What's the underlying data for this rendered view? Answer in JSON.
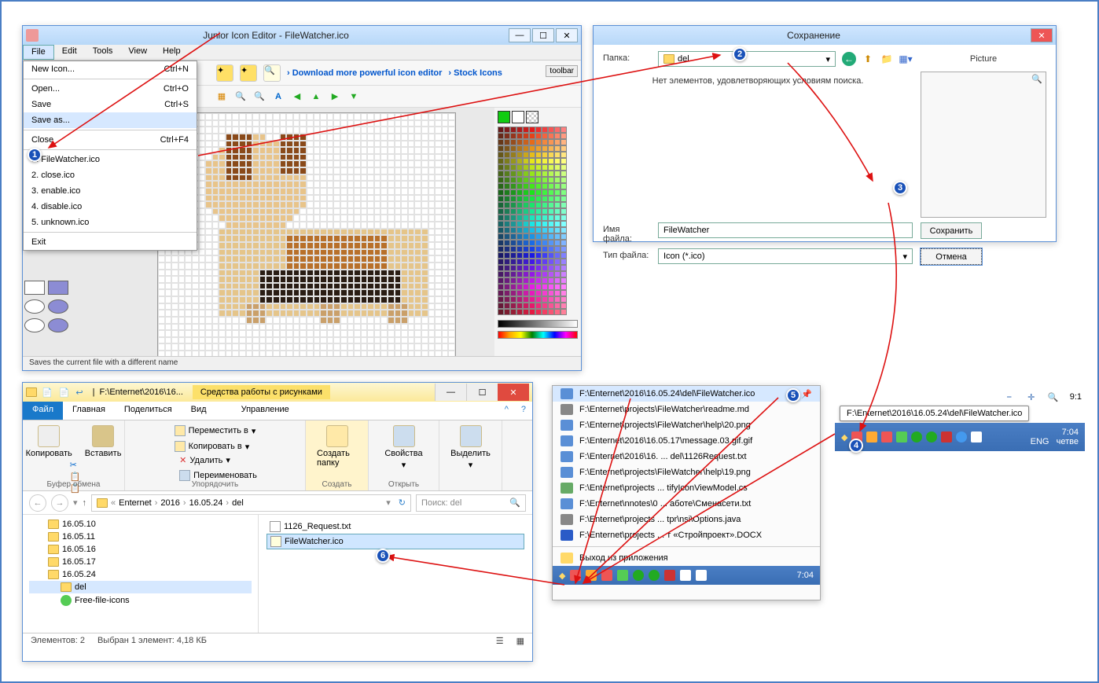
{
  "editor": {
    "title": "Junior Icon Editor - FileWatcher.ico",
    "menubar": [
      "File",
      "Edit",
      "Tools",
      "View",
      "Help"
    ],
    "file_menu": {
      "new": "New Icon...",
      "new_sc": "Ctrl+N",
      "open": "Open...",
      "open_sc": "Ctrl+O",
      "save": "Save",
      "save_sc": "Ctrl+S",
      "saveas": "Save as...",
      "close": "Close",
      "close_sc": "Ctrl+F4",
      "recent": [
        "1. FileWatcher.ico",
        "2. close.ico",
        "3. enable.ico",
        "4. disable.ico",
        "5. unknown.ico"
      ],
      "exit": "Exit"
    },
    "links": {
      "download": "Download more powerful icon editor",
      "stock": "Stock Icons"
    },
    "toolbar_tag": "toolbar",
    "status": "Saves the current file with a different name"
  },
  "savedlg": {
    "title": "Сохранение",
    "folder_label": "Папка:",
    "folder_value": "del",
    "empty_msg": "Нет элементов, удовлетворяющих условиям поиска.",
    "preview_label": "Picture",
    "name_label": "Имя файла:",
    "name_value": "FileWatcher",
    "type_label": "Тип файла:",
    "type_value": "Icon (*.ico)",
    "save_btn": "Сохранить",
    "cancel_btn": "Отмена"
  },
  "explorer": {
    "title_short": "F:\\Enternet\\2016\\16...",
    "tool_context": "Средства работы с рисунками",
    "tabs": {
      "file": "Файл",
      "home": "Главная",
      "share": "Поделиться",
      "view": "Вид",
      "manage": "Управление"
    },
    "ribbon": {
      "copy": "Копировать",
      "paste": "Вставить",
      "move_to": "Переместить в",
      "copy_to": "Копировать в",
      "delete": "Удалить",
      "rename": "Переименовать",
      "new_folder": "Создать папку",
      "properties": "Свойства",
      "select": "Выделить",
      "group_clipboard": "Буфер обмена",
      "group_organize": "Упорядочить",
      "group_new": "Создать",
      "group_open": "Открыть"
    },
    "breadcrumb": [
      "Enternet",
      "2016",
      "16.05.24",
      "del"
    ],
    "search_placeholder": "Поиск: del",
    "tree": [
      "16.05.10",
      "16.05.11",
      "16.05.16",
      "16.05.17",
      "16.05.24",
      "del",
      "Free-file-icons"
    ],
    "files": [
      "1126_Request.txt",
      "FileWatcher.ico"
    ],
    "status_left": "Элементов: 2",
    "status_right": "Выбран 1 элемент: 4,18 КБ"
  },
  "jumplist": {
    "items": [
      "F:\\Enternet\\2016\\16.05.24\\del\\FileWatcher.ico",
      "F:\\Enternet\\projects\\FileWatcher\\readme.md",
      "F:\\Enternet\\projects\\FileWatcher\\help\\20.png",
      "F:\\Enternet\\2016\\16.05.17\\message.03.gif.gif",
      "F:\\Enternet\\2016\\16. ... del\\1126Request.txt",
      "F:\\Enternet\\projects\\FileWatcher\\help\\19.png",
      "F:\\Enternet\\projects ... tifyIconViewModel.cs",
      "F:\\Enternet\\nnotes\\0 ... аботе\\Сменасети.txt",
      "F:\\Enternet\\projects ... tpr\\nsi\\Options.java",
      "F:\\Enternet\\projects ... т «Стройпроект».DOCX"
    ],
    "exit": "Выход из приложения",
    "clock": "7:04"
  },
  "tray2": {
    "tooltip": "F:\\Enternet\\2016\\16.05.24\\del\\FileWatcher.ico",
    "zoom": "9:1",
    "lang": "ENG",
    "clock": "7:04",
    "day": "четве"
  },
  "steps": {
    "s1": "1",
    "s2": "2",
    "s3": "3",
    "s4": "4",
    "s5": "5",
    "s6": "6"
  }
}
